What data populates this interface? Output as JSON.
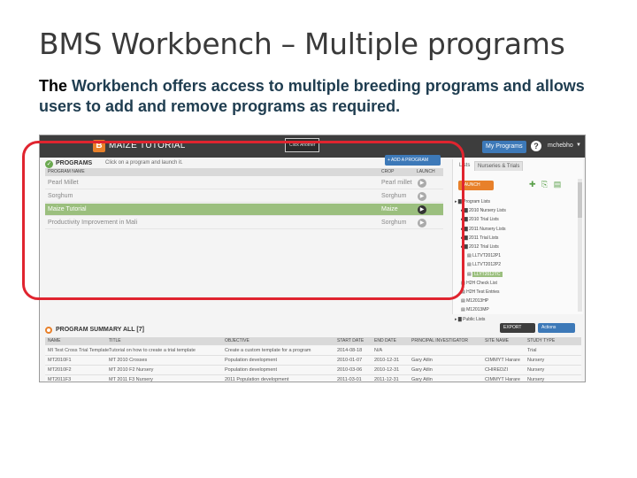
{
  "slide": {
    "title": "BMS Workbench – Multiple programs",
    "body_lead": "The",
    "body_rest": " Workbench offers access to multiple breeding programs and allows users to add and remove programs as required."
  },
  "app": {
    "logo_letter": "B",
    "title": "MAIZE TUTORIAL",
    "tooltip": "Click Another",
    "my_programs": "My Programs",
    "help": "?",
    "user": "mchebho",
    "accent": "#3d79b8",
    "orange": "#e8802a",
    "selected_green": "#9bbf7e"
  },
  "programs": {
    "title": "PROGRAMS",
    "hint": "Click on a program and launch it.",
    "add_button": "+ ADD A PROGRAM",
    "columns": {
      "name": "PROGRAM NAME",
      "crop": "CROP",
      "launch": "LAUNCH"
    },
    "rows": [
      {
        "name": "Pearl Millet",
        "crop": "Pearl millet",
        "selected": false
      },
      {
        "name": "Sorghum",
        "crop": "Sorghum",
        "selected": false
      },
      {
        "name": "Maize Tutorial",
        "crop": "Maize",
        "selected": true
      },
      {
        "name": "Productivity Improvement in Mali",
        "crop": "Sorghum",
        "selected": false
      }
    ]
  },
  "right_panel": {
    "tabs": [
      "Lists",
      "Nurseries & Trials"
    ],
    "launch_button": "LAUNCH",
    "tree": [
      {
        "label": "Program Lists",
        "level": 0,
        "icon": "folder-icon"
      },
      {
        "label": "2010 Nursery Lists",
        "level": 1,
        "icon": "folder-icon"
      },
      {
        "label": "2010 Trial Lists",
        "level": 1,
        "icon": "folder-icon"
      },
      {
        "label": "2011 Nursery Lists",
        "level": 1,
        "icon": "folder-icon"
      },
      {
        "label": "2011 Trial Lists",
        "level": 1,
        "icon": "folder-icon"
      },
      {
        "label": "2012 Trial Lists",
        "level": 1,
        "icon": "folder-icon"
      },
      {
        "label": "LLTVT2012P1",
        "level": 2,
        "icon": "list-icon"
      },
      {
        "label": "LLTVT2012P2",
        "level": 2,
        "icon": "list-icon"
      },
      {
        "label": "LLYT2012TC",
        "level": 2,
        "icon": "list-icon",
        "highlight": true
      },
      {
        "label": "H2H Check List",
        "level": 1,
        "icon": "list-icon"
      },
      {
        "label": "H2H Test Entries",
        "level": 1,
        "icon": "list-icon"
      },
      {
        "label": "M12013HP",
        "level": 1,
        "icon": "list-icon"
      },
      {
        "label": "M12013MP",
        "level": 1,
        "icon": "list-icon"
      },
      {
        "label": "Public Lists",
        "level": 0,
        "icon": "folder-icon"
      }
    ]
  },
  "summary": {
    "title": "PROGRAM SUMMARY ALL [7]",
    "export_button": "EXPORT",
    "actions_button": "Actions",
    "columns": [
      "NAME",
      "TITLE",
      "OBJECTIVE",
      "START DATE",
      "END DATE",
      "PRINCIPAL INVESTIGATOR",
      "SITE NAME",
      "STUDY TYPE"
    ],
    "rows": [
      [
        "MI Test Cross Trial Template",
        "Tutorial on how to create a trial template",
        "Create a custom template for a program",
        "2014-08-18",
        "N/A",
        "",
        "",
        "Trial"
      ],
      [
        "MT2010F1",
        "MT 2010 Crosses",
        "Population development",
        "2010-01-07",
        "2010-12-31",
        "Gary Atlin",
        "CIMMYT Harare",
        "Nursery"
      ],
      [
        "MT2010F2",
        "MT 2010 F2 Nursery",
        "Population development",
        "2010-03-06",
        "2010-12-31",
        "Gary Atlin",
        "CHIREDZI",
        "Nursery"
      ],
      [
        "MT2011F3",
        "MT 2011 F3 Nursery",
        "2011 Population development",
        "2011-03-01",
        "2011-12-31",
        "Gary Atlin",
        "CIMMYT Harare",
        "Nursery"
      ]
    ]
  }
}
